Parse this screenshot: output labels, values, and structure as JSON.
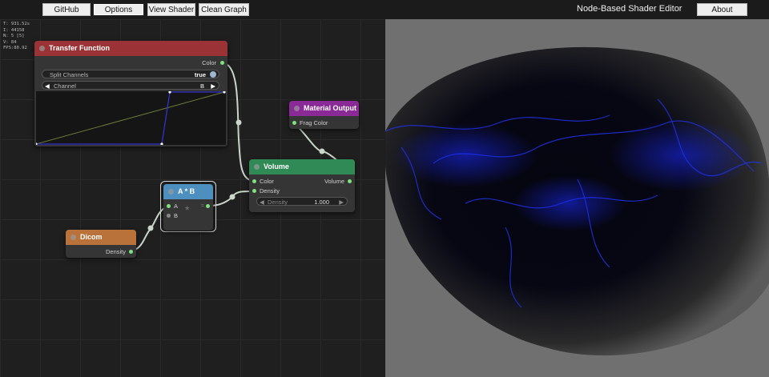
{
  "toolbar": {
    "github": "GitHub",
    "options": "Options",
    "view_shader": "View Shader",
    "clean_graph": "Clean Graph",
    "about": "About"
  },
  "app_title": "Node-Based Shader Editor",
  "stats": {
    "t": "T: 931.52s",
    "i": "I: 44158",
    "n": "N: 5 [5]",
    "v": "V: 84",
    "fps": "FPS:80.92"
  },
  "nodes": {
    "transfer_function": {
      "title": "Transfer Function",
      "color": "#9b3336",
      "output": "Color",
      "split_channels_label": "Split Channels",
      "split_channels_value": "true",
      "channel_label": "Channel",
      "channel_value": "B"
    },
    "material_output": {
      "title": "Material Output",
      "color": "#8a2a96",
      "input": "Frag Color"
    },
    "volume": {
      "title": "Volume",
      "color": "#2f8a55",
      "input_color": "Color",
      "input_density": "Density",
      "output": "Volume",
      "density_label": "Density",
      "density_value": "1.000"
    },
    "multiply": {
      "title": "A * B",
      "color": "#4d8fbf",
      "input_a": "A",
      "input_b": "B",
      "operator": "*",
      "output": "="
    },
    "dicom": {
      "title": "Dicom",
      "color": "#b8723a",
      "output": "Density"
    }
  }
}
